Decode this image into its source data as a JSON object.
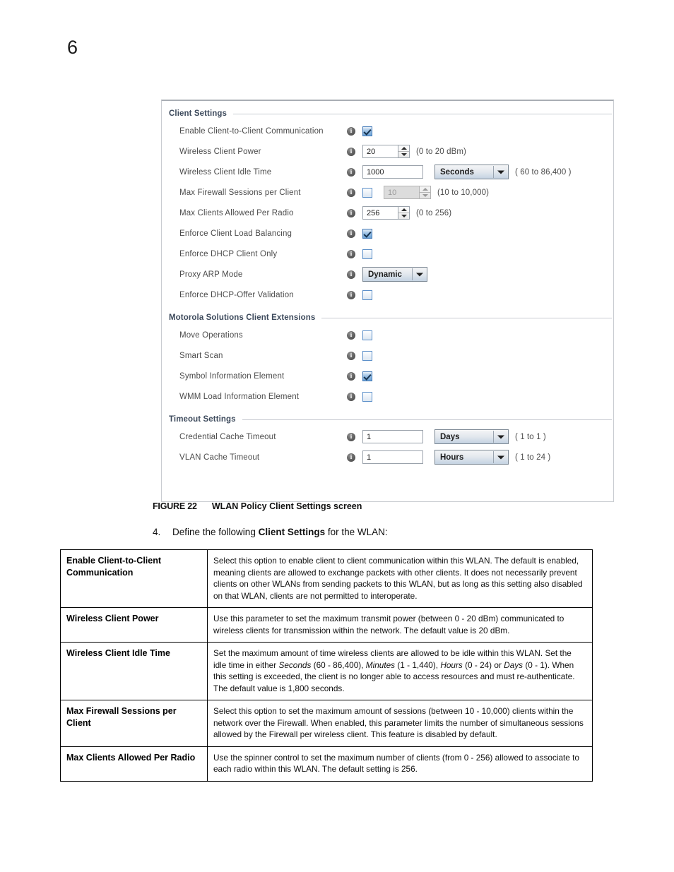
{
  "page": {
    "number": "6"
  },
  "figure": {
    "label": "FIGURE 22",
    "caption": "WLAN Policy Client Settings screen"
  },
  "step": {
    "number": "4.",
    "text_before": "Define the following ",
    "bold_term": "Client Settings",
    "text_after": " for the WLAN:"
  },
  "screenshot": {
    "sections": [
      {
        "title": "Client Settings",
        "rows": [
          {
            "label": "Enable Client-to-Client Communication",
            "control": "checkbox",
            "checked": true,
            "hint": ""
          },
          {
            "label": "Wireless Client Power",
            "control": "spinner",
            "value": "20",
            "hint": "(0 to 20 dBm)"
          },
          {
            "label": "Wireless Client Idle Time",
            "control": "text-dropdown",
            "value": "1000",
            "unit": "Seconds",
            "hint": "( 60 to 86,400 )"
          },
          {
            "label": "Max Firewall Sessions per Client",
            "control": "checkbox-spinner",
            "checked": false,
            "value": "10",
            "disabled": true,
            "hint": "(10 to 10,000)"
          },
          {
            "label": "Max Clients Allowed Per Radio",
            "control": "spinner",
            "value": "256",
            "hint": "(0 to 256)"
          },
          {
            "label": "Enforce Client Load Balancing",
            "control": "checkbox",
            "checked": true,
            "hint": ""
          },
          {
            "label": "Enforce DHCP Client Only",
            "control": "checkbox",
            "checked": false,
            "hint": ""
          },
          {
            "label": "Proxy ARP Mode",
            "control": "dropdown",
            "value": "Dynamic",
            "hint": ""
          },
          {
            "label": "Enforce DHCP-Offer Validation",
            "control": "checkbox",
            "checked": false,
            "hint": ""
          }
        ]
      },
      {
        "title": "Motorola Solutions Client Extensions",
        "rows": [
          {
            "label": "Move Operations",
            "control": "checkbox",
            "checked": false,
            "hint": ""
          },
          {
            "label": "Smart Scan",
            "control": "checkbox",
            "checked": false,
            "hint": ""
          },
          {
            "label": "Symbol Information Element",
            "control": "checkbox",
            "checked": true,
            "hint": ""
          },
          {
            "label": "WMM Load Information Element",
            "control": "checkbox",
            "checked": false,
            "hint": ""
          }
        ]
      },
      {
        "title": "Timeout Settings",
        "rows": [
          {
            "label": "Credential Cache Timeout",
            "control": "text-dropdown",
            "value": "1",
            "unit": "Days",
            "hint": "( 1 to 1 )"
          },
          {
            "label": "VLAN Cache Timeout",
            "control": "text-dropdown",
            "value": "1",
            "unit": "Hours",
            "hint": "( 1 to 24 )"
          }
        ]
      }
    ]
  },
  "definitions": [
    {
      "term": "Enable Client-to-Client Communication",
      "description": "Select this option to enable client to client communication within this WLAN. The default is enabled, meaning clients are allowed to exchange packets with other clients. It does not necessarily prevent clients on other WLANs from sending packets to this WLAN, but as long as this setting also disabled on that WLAN, clients are not permitted to interoperate."
    },
    {
      "term": "Wireless Client Power",
      "description": "Use this parameter to set the maximum transmit power (between 0 - 20 dBm) communicated to wireless clients for transmission within the network. The default value is 20 dBm."
    },
    {
      "term": "Wireless Client Idle Time",
      "description": "Set the maximum amount of time wireless clients are allowed to be idle within this WLAN. Set the idle time in either Seconds (60 - 86,400), Minutes (1 - 1,440), Hours (0 - 24) or Days (0 - 1). When this setting is exceeded, the client is no longer able to access resources and must re-authenticate. The default value is 1,800 seconds."
    },
    {
      "term": "Max Firewall Sessions per Client",
      "description": "Select this option to set the maximum amount of sessions (between 10 - 10,000) clients within the network over the Firewall. When enabled, this parameter limits the number of simultaneous sessions allowed by the Firewall per wireless client. This feature is disabled by default."
    },
    {
      "term": "Max Clients Allowed Per Radio",
      "description": "Use the spinner control to set the maximum number of clients (from 0 - 256) allowed to associate to each radio within this WLAN. The default setting is 256."
    }
  ]
}
